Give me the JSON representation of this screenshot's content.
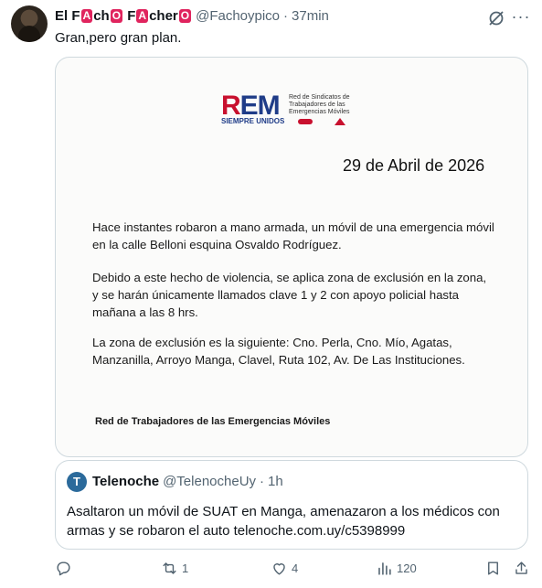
{
  "tweet": {
    "display_name_parts": [
      "El F",
      "A",
      "ch",
      "O",
      " F",
      "A",
      "cher",
      "O"
    ],
    "handle": "@Fachoypico",
    "separator": "·",
    "time": "37min",
    "text": "Gran,pero gran plan.",
    "more_glyph": "···"
  },
  "image": {
    "logo_letters_r": "R",
    "logo_letters_em": "EM",
    "logo_subtitle": "SIEMPRE UNIDOS",
    "logo_org": "Red de Sindicatos de Trabajadores de las Emergencias Móviles",
    "date": "29 de Abril de 2026",
    "paragraph1": "Hace instantes robaron a mano armada, un móvil de una emergencia móvil en la calle Belloni esquina Osvaldo Rodríguez.",
    "paragraph2": "Debido a este hecho de violencia, se aplica zona de exclusión en la zona, y se harán únicamente llamados clave 1 y 2 con apoyo policial hasta mañana a las 8 hrs.",
    "paragraph3": "La zona de exclusión es la siguiente: Cno. Perla, Cno. Mío, Agatas, Manzanilla, Arroyo Manga, Clavel, Ruta 102, Av. De Las Instituciones.",
    "signature": "Red de Trabajadores de las Emergencias Móviles"
  },
  "quote": {
    "avatar_letter": "T",
    "name": "Telenoche",
    "handle": "@TelenocheUy",
    "separator": "·",
    "time": "1h",
    "text": "Asaltaron un móvil de SUAT en Manga, amenazaron a los médicos con armas y se robaron el auto telenoche.com.uy/c5398999"
  },
  "actions": {
    "reply_count": "",
    "retweet_count": "1",
    "like_count": "4",
    "views_count": "120"
  },
  "colors": {
    "text": "#0f1419",
    "secondary": "#536471",
    "border": "#cfd9de",
    "badge": "#e0245e"
  }
}
